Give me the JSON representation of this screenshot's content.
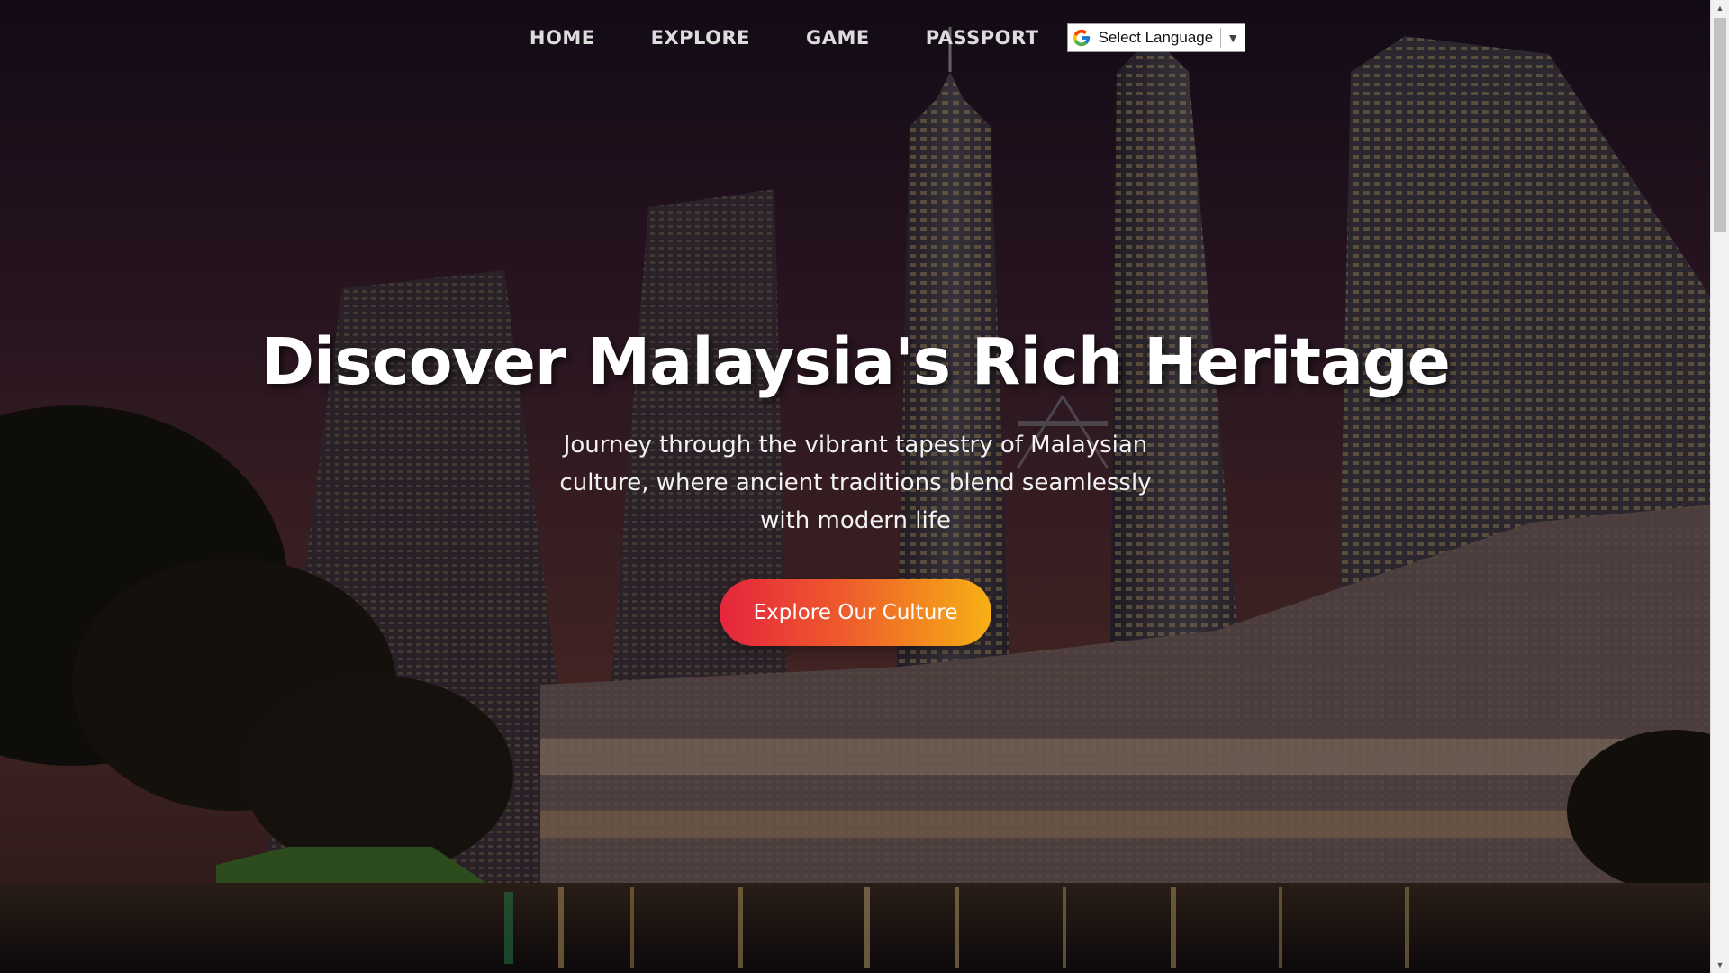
{
  "nav": {
    "items": [
      {
        "label": "HOME"
      },
      {
        "label": "EXPLORE"
      },
      {
        "label": "GAME"
      },
      {
        "label": "PASSPORT"
      }
    ],
    "language_select": {
      "label": "Select Language",
      "icon": "google-g-icon",
      "arrow": "▼"
    }
  },
  "hero": {
    "title": "Discover Malaysia's Rich Heritage",
    "subtitle": "Journey through the vibrant tapestry of Malaysian culture, where ancient traditions blend seamlessly with modern life",
    "cta_label": "Explore Our Culture"
  },
  "background": {
    "icon": "kuala-lumpur-skyline-image"
  },
  "colors": {
    "cta_start": "#e5253d",
    "cta_end": "#f7b014",
    "nav_text": "#dcdcdc",
    "title_text": "#ffffff"
  }
}
